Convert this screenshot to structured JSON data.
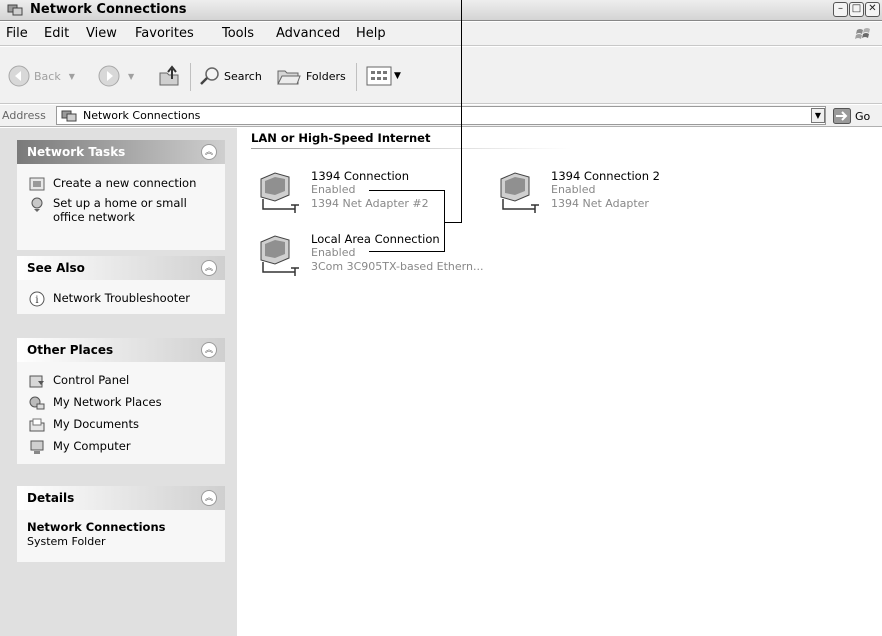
{
  "window": {
    "title": "Network Connections",
    "buttons": {
      "minimize": "–",
      "maximize": "□",
      "close": "✕"
    }
  },
  "menu": [
    "File",
    "Edit",
    "View",
    "Favorites",
    "Tools",
    "Advanced",
    "Help"
  ],
  "toolbar": {
    "back": "Back",
    "search": "Search",
    "folders": "Folders"
  },
  "address": {
    "label": "Address",
    "value": "Network Connections",
    "go": "Go"
  },
  "sidebar": {
    "network_tasks": {
      "title": "Network Tasks",
      "items": [
        "Create a new connection",
        "Set up a home or small office network"
      ]
    },
    "see_also": {
      "title": "See Also",
      "items": [
        "Network Troubleshooter"
      ]
    },
    "other_places": {
      "title": "Other Places",
      "items": [
        "Control Panel",
        "My Network Places",
        "My Documents",
        "My Computer"
      ]
    },
    "details": {
      "title": "Details",
      "name": "Network Connections",
      "type": "System Folder"
    }
  },
  "content": {
    "group": "LAN or High-Speed Internet",
    "connections": [
      {
        "name": "1394 Connection",
        "status": "Enabled",
        "device": "1394 Net Adapter #2"
      },
      {
        "name": "1394 Connection 2",
        "status": "Enabled",
        "device": "1394 Net Adapter"
      },
      {
        "name": "Local Area Connection",
        "status": "Enabled",
        "device": "3Com 3C905TX-based Ethern..."
      }
    ]
  },
  "icons": {
    "collapse_chevron": "chevron-up-icon",
    "go_arrow": "arrow-right-icon"
  }
}
